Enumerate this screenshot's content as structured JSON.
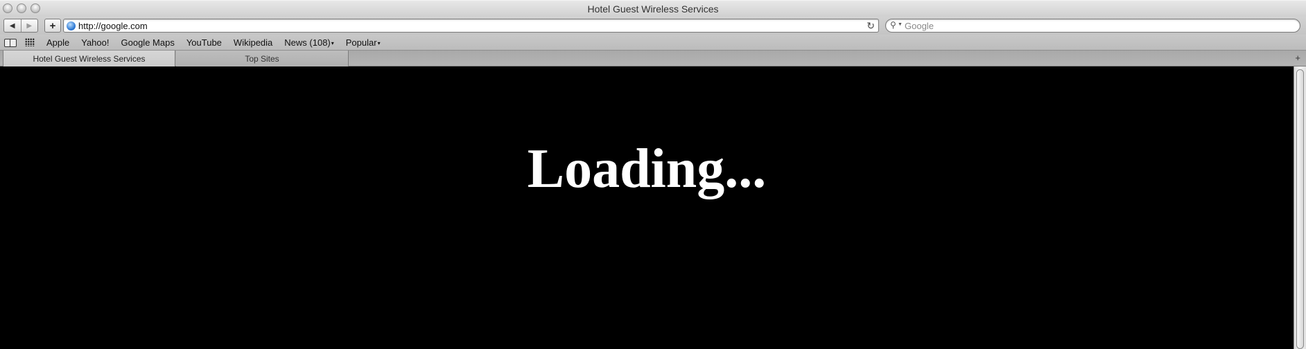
{
  "window": {
    "title": "Hotel Guest Wireless Services",
    "traffic_lights": [
      "close",
      "minimize",
      "zoom"
    ]
  },
  "toolbar": {
    "back_icon": "◀",
    "forward_icon": "▶",
    "add_bookmark_icon": "+",
    "url": "http://google.com",
    "reload_icon": "↻",
    "search_placeholder": "Google",
    "search_icon": "🔍"
  },
  "bookmarks": {
    "items": [
      {
        "label": "Apple",
        "has_menu": false
      },
      {
        "label": "Yahoo!",
        "has_menu": false
      },
      {
        "label": "Google Maps",
        "has_menu": false
      },
      {
        "label": "YouTube",
        "has_menu": false
      },
      {
        "label": "Wikipedia",
        "has_menu": false
      },
      {
        "label": "News (108)",
        "has_menu": true
      },
      {
        "label": "Popular",
        "has_menu": true
      }
    ],
    "menu_arrow": "▾"
  },
  "tabs": [
    {
      "label": "Hotel Guest Wireless Services",
      "active": true
    },
    {
      "label": "Top Sites",
      "active": false
    }
  ],
  "new_tab_icon": "+",
  "content": {
    "message": "Loading...",
    "background": "#000000",
    "text_color": "#ffffff"
  }
}
